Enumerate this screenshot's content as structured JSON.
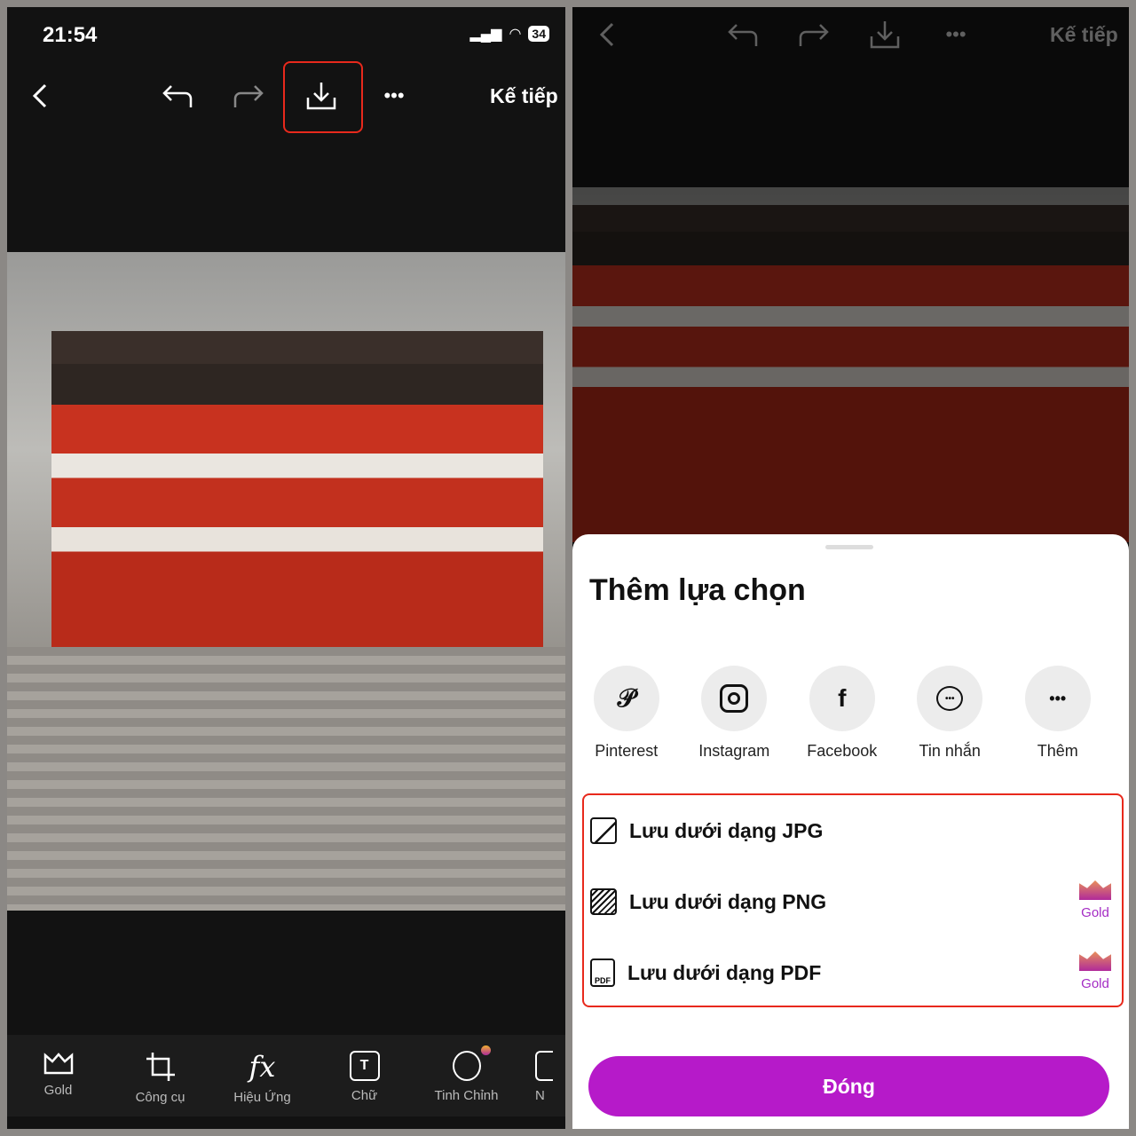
{
  "status": {
    "time": "21:54",
    "battery": "34"
  },
  "toolbar": {
    "next_label": "Kế tiếp"
  },
  "bottom_tools": [
    {
      "label": "Gold",
      "icon": "crown-icon"
    },
    {
      "label": "Công cụ",
      "icon": "crop-icon"
    },
    {
      "label": "Hiệu Ứng",
      "icon": "fx-icon"
    },
    {
      "label": "Chữ",
      "icon": "text-icon"
    },
    {
      "label": "Tinh Chỉnh",
      "icon": "retouch-icon"
    },
    {
      "label": "N",
      "icon": "more-tool-icon"
    }
  ],
  "sheet": {
    "title": "Thêm lựa chọn",
    "shares": [
      {
        "label": "Pinterest",
        "glyph": "P"
      },
      {
        "label": "Instagram",
        "glyph": "◎"
      },
      {
        "label": "Facebook",
        "glyph": "f"
      },
      {
        "label": "Tin nhắn",
        "glyph": "💬"
      },
      {
        "label": "Thêm",
        "glyph": "•••"
      }
    ],
    "options": [
      {
        "label": "Lưu dưới dạng JPG"
      },
      {
        "label": "Lưu dưới dạng PNG",
        "badge": "Gold"
      },
      {
        "label": "Lưu dưới dạng PDF",
        "badge": "Gold"
      }
    ],
    "close_label": "Đóng"
  },
  "colors": {
    "accent": "#b61ac9",
    "highlight": "#e8291c",
    "gold": "#a42bc4"
  }
}
